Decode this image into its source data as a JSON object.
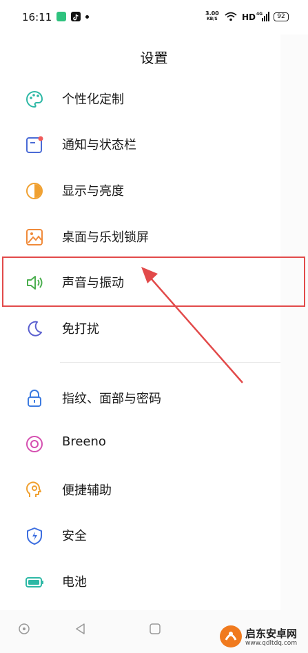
{
  "status_bar": {
    "time": "16:11",
    "net_speed_value": "3.00",
    "net_speed_unit": "KB/S",
    "hd_label": "HD",
    "battery": "92",
    "colors": {
      "app1": "#2ec27e",
      "app2": "#111111"
    }
  },
  "header": {
    "title": "设置"
  },
  "settings": {
    "items": [
      {
        "label": "个性化定制",
        "icon": "palette-icon",
        "color": "#2db8a5"
      },
      {
        "label": "通知与状态栏",
        "icon": "notification-icon",
        "color": "#4a6bd6"
      },
      {
        "label": "显示与亮度",
        "icon": "brightness-icon",
        "color": "#f0a030"
      },
      {
        "label": "桌面与乐划锁屏",
        "icon": "wallpaper-icon",
        "color": "#f08a3a"
      },
      {
        "label": "声音与振动",
        "icon": "speaker-icon",
        "color": "#4caf50"
      },
      {
        "label": "免打扰",
        "icon": "moon-icon",
        "color": "#5a5fcf"
      },
      {
        "label": "指纹、面部与密码",
        "icon": "lock-icon",
        "color": "#3d7be0"
      },
      {
        "label": "Breeno",
        "icon": "breeno-icon",
        "color": "#d54fb0"
      },
      {
        "label": "便捷辅助",
        "icon": "assist-icon",
        "color": "#f0a030"
      },
      {
        "label": "安全",
        "icon": "shield-icon",
        "color": "#3d6fe0"
      },
      {
        "label": "电池",
        "icon": "battery-icon",
        "color": "#2db8a5"
      }
    ]
  },
  "annotation": {
    "highlight_color": "#e24a4a",
    "target": "声音与振动"
  },
  "watermark": {
    "name": "启东安卓网",
    "url": "www.qdltdq.com"
  }
}
